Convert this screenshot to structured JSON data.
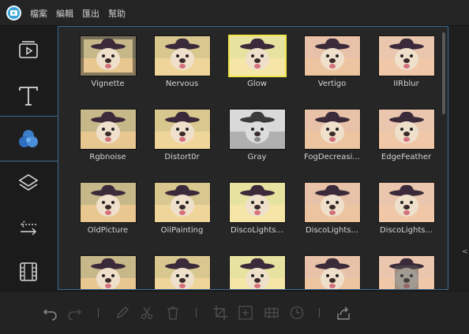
{
  "menubar": {
    "logo_icon": "app-logo-icon",
    "items": [
      "檔案",
      "編輯",
      "匯出",
      "幫助"
    ]
  },
  "sidebar": {
    "items": [
      {
        "name": "media",
        "icon": "play-clip-icon"
      },
      {
        "name": "text",
        "icon": "text-t-icon"
      },
      {
        "name": "filters",
        "icon": "filters-circles-icon",
        "active": true
      },
      {
        "name": "overlays",
        "icon": "layers-icon"
      },
      {
        "name": "transitions",
        "icon": "transition-arrows-icon"
      },
      {
        "name": "elements",
        "icon": "film-strip-icon"
      }
    ]
  },
  "filters": {
    "items": [
      {
        "label": "Vignette"
      },
      {
        "label": "Nervous"
      },
      {
        "label": "Glow",
        "selected": true
      },
      {
        "label": "Vertigo"
      },
      {
        "label": "IIRblur"
      },
      {
        "label": "Rgbnoise"
      },
      {
        "label": "Distort0r"
      },
      {
        "label": "Gray"
      },
      {
        "label": "FogDecreasi..."
      },
      {
        "label": "EdgeFeather"
      },
      {
        "label": "OldPicture"
      },
      {
        "label": "OilPainting"
      },
      {
        "label": "DiscoLights..."
      },
      {
        "label": "DiscoLights..."
      },
      {
        "label": "DiscoLights..."
      },
      {
        "label": ""
      },
      {
        "label": ""
      },
      {
        "label": ""
      },
      {
        "label": ""
      },
      {
        "label": ""
      }
    ]
  },
  "toolbar": {
    "icons": [
      "undo-icon",
      "redo-icon",
      "edit-pencil-icon",
      "cut-scissors-icon",
      "delete-trash-icon",
      "crop-icon",
      "zoom-icon",
      "mosaic-icon",
      "speed-clock-icon",
      "export-share-icon"
    ]
  },
  "colors": {
    "accent_border": "#3b6b96",
    "selected_border": "#f0e64a",
    "logo_blue": "#3aa3d8"
  }
}
